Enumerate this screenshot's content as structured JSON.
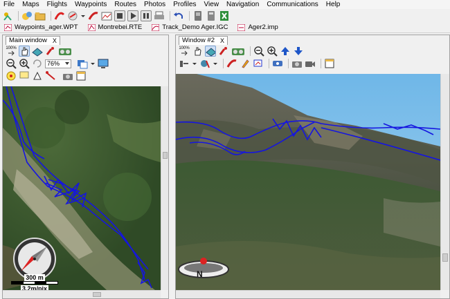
{
  "menu": [
    "File",
    "Maps",
    "Flights",
    "Waypoints",
    "Routes",
    "Photos",
    "Profiles",
    "View",
    "Navigation",
    "Communications",
    "Help"
  ],
  "files": [
    {
      "name": "Waypoints_ager.WPT",
      "icon": "waypoints-file-icon"
    },
    {
      "name": "Montrebei.RTE",
      "icon": "route-file-icon"
    },
    {
      "name": "Track_Demo Ager.IGC",
      "icon": "track-file-icon"
    },
    {
      "name": "Ager2.imp",
      "icon": "map-file-icon"
    }
  ],
  "left_pane": {
    "title": "Main window",
    "close": "X",
    "zoom_level": "76%",
    "zoom_fit": "100%",
    "scale_distance": "300 m",
    "scale_resolution": "3.2m/pix"
  },
  "right_pane": {
    "title": "Window #2",
    "close": "X",
    "zoom_fit": "100%",
    "compass_letter": "N"
  },
  "colors": {
    "track": "#1515e0",
    "sky": "#6fb7e8"
  }
}
